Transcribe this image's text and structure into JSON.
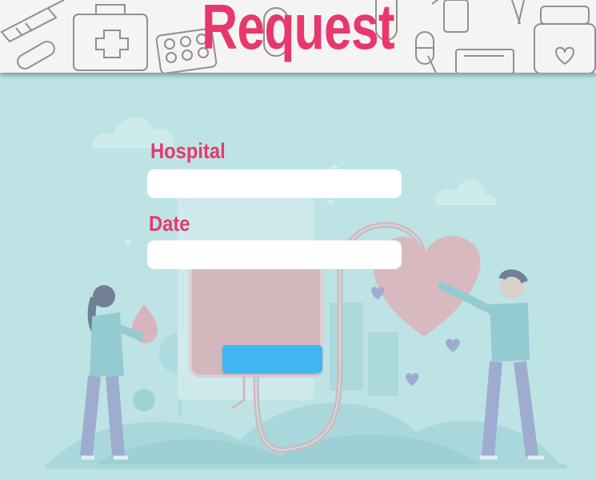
{
  "header": {
    "title": "Request",
    "title_color": "#e8386b",
    "background": "#f4f4f4"
  },
  "form": {
    "hospital_label": "Hospital",
    "hospital_value": "",
    "date_label": "Date",
    "date_value": "",
    "submit_label": "",
    "submit_color": "#3fb6f2",
    "label_color": "#e8386b"
  },
  "background": {
    "color": "#bde3e4",
    "illustration": "blood-donation-illustration"
  }
}
